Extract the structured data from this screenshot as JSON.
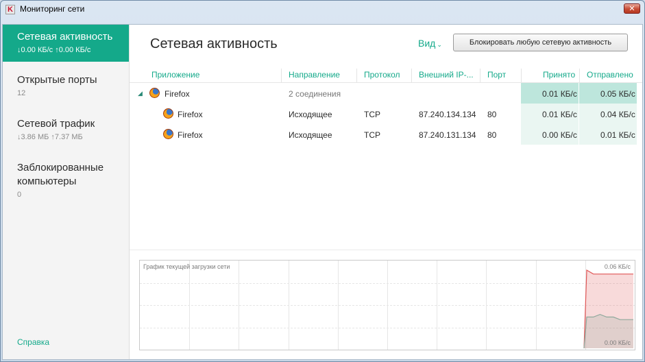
{
  "window": {
    "title": "Мониторинг сети",
    "app_icon_glyph": "K",
    "close_glyph": "✕"
  },
  "sidebar": {
    "items": [
      {
        "label": "Сетевая активность",
        "sub": "↓0.00 КБ/с ↑0.00 КБ/с",
        "active": true
      },
      {
        "label": "Открытые порты",
        "sub": "12"
      },
      {
        "label": "Сетевой трафик",
        "sub": "↓3.86 МБ ↑7.37 МБ"
      },
      {
        "label": "Заблокированные компьютеры",
        "sub": "0"
      }
    ],
    "help": "Справка"
  },
  "main": {
    "title": "Сетевая активность",
    "view_label": "Вид",
    "view_chevron": "⌄",
    "block_button": "Блокировать любую сетевую активность"
  },
  "table": {
    "columns": [
      "Приложение",
      "Направление",
      "Протокол",
      "Внешний IP-...",
      "Порт",
      "Принято",
      "Отправлено"
    ],
    "group": {
      "app": "Firefox",
      "direction": "2 соединения",
      "received": "0.01 КБ/с",
      "sent": "0.05 КБ/с",
      "expander_glyph": "◢"
    },
    "rows": [
      {
        "app": "Firefox",
        "direction": "Исходящее",
        "protocol": "TCP",
        "ip": "87.240.134.134",
        "port": "80",
        "received": "0.01 КБ/с",
        "sent": "0.04 КБ/с"
      },
      {
        "app": "Firefox",
        "direction": "Исходящее",
        "protocol": "TCP",
        "ip": "87.240.131.134",
        "port": "80",
        "received": "0.00 КБ/с",
        "sent": "0.01 КБ/с"
      }
    ]
  },
  "graph": {
    "title": "График текущей загрузки сети",
    "max_label": "0.06 КБ/с",
    "min_label": "0.00 КБ/с",
    "ymax": 0.06,
    "sent_color": "#e05555",
    "received_color": "#8fa89c",
    "sent_series": [
      0,
      0.06,
      0.057,
      0.057,
      0.057,
      0.057,
      0.057,
      0.057,
      0.057
    ],
    "received_series": [
      0,
      0.024,
      0.024,
      0.026,
      0.024,
      0.024,
      0.022,
      0.022,
      0.022
    ]
  },
  "colors": {
    "accent": "#14a98a",
    "highlight_received": "#bde6dc",
    "highlight_light": "#eaf6f2"
  }
}
